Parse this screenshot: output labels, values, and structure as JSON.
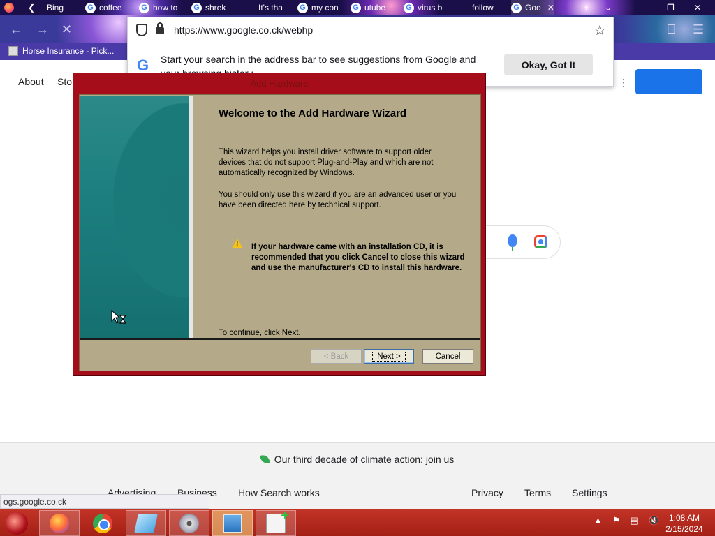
{
  "browser": {
    "tabs": [
      {
        "label": "Bing"
      },
      {
        "label": "coffee"
      },
      {
        "label": "how to"
      },
      {
        "label": "shrek"
      },
      {
        "label": "It's tha"
      },
      {
        "label": "my con"
      },
      {
        "label": "utube"
      },
      {
        "label": "virus b"
      },
      {
        "label": "follow"
      },
      {
        "label": "Goo"
      }
    ],
    "url": "https://www.google.co.ck/webhp",
    "bookmark": "Horse Insurance - Pick...",
    "suggestion_text": "Start your search in the address bar to see suggestions from Google and your browsing history",
    "suggestion_button": "Okay, Got It"
  },
  "page": {
    "about": "About",
    "store": "Sto",
    "climate": "Our third decade of climate action: join us",
    "footer_links": [
      "Advertising",
      "Business",
      "How Search works",
      "Privacy",
      "Terms",
      "Settings"
    ],
    "status_url": "ogs.google.co.ck",
    "brand_color": "#1a73e8"
  },
  "wizard": {
    "title": "Add Hardware",
    "heading": "Welcome to the Add Hardware Wizard",
    "para1": "This wizard helps you install driver software to support older devices that do not support Plug-and-Play and which are not automatically recognized by Windows.",
    "para2": "You should only use this wizard if you are an advanced user or you have been directed here by technical support.",
    "warning": "If your hardware came with an installation CD, it is recommended that you click Cancel to close this wizard and use the manufacturer's CD to install this hardware.",
    "continue": "To continue, click Next.",
    "back_label": "< Back",
    "next_label": "Next >",
    "cancel_label": "Cancel",
    "frame_color": "#a50d1a"
  },
  "taskbar": {
    "time": "1:08 AM",
    "date": "2/15/2024"
  },
  "icons": [
    "firefox-icon",
    "chrome-icon",
    "paint-icon",
    "cd-icon",
    "hardware-icon",
    "add-hardware-icon",
    "shield-icon",
    "lock-icon",
    "star-icon",
    "google-icon",
    "mic-icon",
    "lens-icon",
    "leaf-icon",
    "warning-icon",
    "hourglass-cursor-icon"
  ]
}
